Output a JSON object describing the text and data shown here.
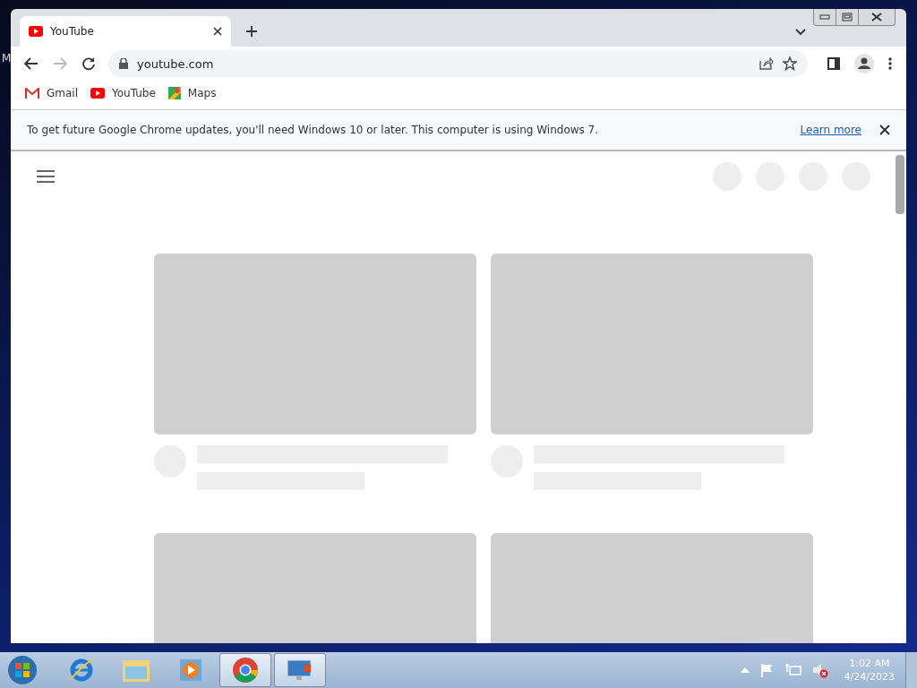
{
  "desktop": {
    "icon_label": "M"
  },
  "browser": {
    "tabs": [
      {
        "title": "YouTube",
        "selected": true
      }
    ],
    "address": "youtube.com",
    "bookmarks": [
      {
        "label": "Gmail",
        "kind": "gmail"
      },
      {
        "label": "YouTube",
        "kind": "youtube"
      },
      {
        "label": "Maps",
        "kind": "maps"
      }
    ],
    "infobar": {
      "message": "To get future Google Chrome updates, you'll need Windows 10 or later. This computer is using Windows 7.",
      "link": "Learn more"
    }
  },
  "taskbar": {
    "items": [
      {
        "kind": "ie",
        "selected": false
      },
      {
        "kind": "explorer",
        "selected": false
      },
      {
        "kind": "media",
        "selected": false
      },
      {
        "kind": "chrome",
        "selected": true
      },
      {
        "kind": "remote",
        "selected": true
      }
    ],
    "time": "1:02 AM",
    "date": "4/24/2023"
  }
}
